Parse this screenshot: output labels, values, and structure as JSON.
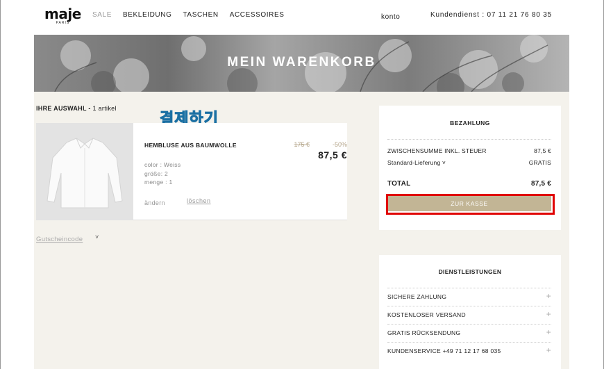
{
  "header": {
    "logo": "maje",
    "logo_sub": "PARIS",
    "nav": [
      "SALE",
      "BEKLEIDUNG",
      "TASCHEN",
      "ACCESSOIRES"
    ],
    "account": "konto",
    "customer_service": "Kundendienst : 07 11 21 76 80 35"
  },
  "banner": {
    "title": "MEIN WARENKORB"
  },
  "cart": {
    "selection_label": "IHRE AUSWAHL - ",
    "selection_count": "1 artikel",
    "annotation": "결제하기",
    "item": {
      "name": "HEMBLUSE AUS BAUMWOLLE",
      "color": "color : Weiss",
      "size": "größe: 2",
      "quantity": "menge : 1",
      "old_price": "175 €",
      "discount": "-50%",
      "price": "87,5 €",
      "change_label": "ändern",
      "delete_label": "löschen"
    },
    "coupon_label": "Gutscheincode",
    "coupon_chevron": "˅"
  },
  "payment": {
    "title": "BEZAHLUNG",
    "subtotal_label": "ZWISCHENSUMME INKL. STEUER",
    "subtotal_value": "87,5 €",
    "shipping_label": "Standard-Lieferung ˅",
    "shipping_value": "GRATIS",
    "total_label": "TOTAL",
    "total_value": "87,5 €",
    "checkout_label": "ZUR KASSE",
    "highlight_color": "#e00000",
    "button_color": "#c2b595"
  },
  "services": {
    "title": "DIENSTLEISTUNGEN",
    "items": [
      "SICHERE ZAHLUNG",
      "KOSTENLOSER VERSAND",
      "GRATIS RÜCKSENDUNG",
      "KUNDENSERVICE +49 71 12 17 68 035"
    ],
    "expand_icon": "+"
  }
}
